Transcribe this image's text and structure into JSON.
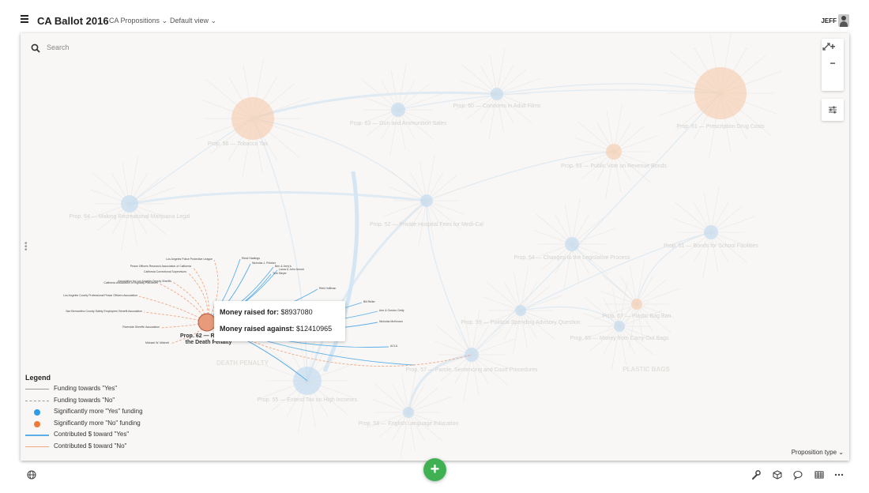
{
  "app": {
    "title": "CA Ballot 2016",
    "dataset": "CA Propositions",
    "view": "Default view",
    "user": "JEFF"
  },
  "search": {
    "placeholder": "Search"
  },
  "zoom": {
    "in": "+",
    "out": "−"
  },
  "tooltip": {
    "for_label": "Money raised for:",
    "for_value": "$8937080",
    "against_label": "Money raised against:",
    "against_value": "$12410965"
  },
  "legend": {
    "title": "Legend",
    "items": [
      {
        "label": "Funding towards \"Yes\"",
        "color": "#9a9a9a",
        "style": "solid"
      },
      {
        "label": "Funding towards \"No\"",
        "color": "#9a9a9a",
        "style": "dashed"
      },
      {
        "label": "Significantly more \"Yes\" funding",
        "color": "#2f9ae6",
        "style": "dot"
      },
      {
        "label": "Significantly more \"No\" funding",
        "color": "#f07a3a",
        "style": "dot"
      },
      {
        "label": "Contributed $ toward \"Yes\"",
        "color": "#5aaee8",
        "style": "solid"
      },
      {
        "label": "Contributed $ toward \"No\"",
        "color": "#f0a785",
        "style": "solid"
      }
    ]
  },
  "proposition_type_label": "Proposition type",
  "focus_node": {
    "label_line1": "Prop. 62 — Repealing",
    "label_line2": "the Death Penalty",
    "color": "#e79a7c"
  },
  "nodes": [
    {
      "label": "Prop. 56 — Tobacco Tax",
      "color": "#f6c6a4"
    },
    {
      "label": "Prop. 63 — Gun and Ammunition Sales",
      "color": "#b8d6ef"
    },
    {
      "label": "Prop. 60 — Condoms in Adult Films",
      "color": "#b8d6ef"
    },
    {
      "label": "Prop. 61 — Prescription Drug Costs",
      "color": "#f6c6a4"
    },
    {
      "label": "Prop. 53 — Public Vote on Revenue Bonds",
      "color": "#f6c6a4"
    },
    {
      "label": "Prop. 64 — Making Recreational Marijuana Legal",
      "color": "#b8d6ef"
    },
    {
      "label": "Prop. 52 — Private Hospital Fees for Medi-Cal",
      "color": "#b8d6ef"
    },
    {
      "label": "Prop. 54 — Changes to the Legislative Process",
      "color": "#b8d6ef"
    },
    {
      "label": "Prop. 51 — Bonds for School Facilities",
      "color": "#b8d6ef"
    },
    {
      "label": "Prop. 59 — Political Spending Advisory Question",
      "color": "#b8d6ef"
    },
    {
      "label": "Prop. 67 — Plastic Bag Ban",
      "color": "#f6c6a4"
    },
    {
      "label": "Prop. 65 — Money from Carry-Out Bags",
      "color": "#b8d6ef"
    },
    {
      "label": "Prop. 57 — Parole, Sentencing and Court Procedures",
      "color": "#b8d6ef"
    },
    {
      "label": "Prop. 55 — Extend Tax on High Incomes",
      "color": "#b8d6ef"
    },
    {
      "label": "Prop. 58 — English Language Education",
      "color": "#b8d6ef"
    }
  ],
  "group_labels": [
    "DEATH PENALTY",
    "PLASTIC BAGS"
  ],
  "contributors_no": [
    "Los Angeles Police Protective League",
    "Peace Officers Research Association of California",
    "California Correctional Supervisors",
    "Association for Los Angeles Deputy Sheriffs",
    "California Association of Highway Patrolmen",
    "Los Angeles County Professional Peace Officers Association",
    "San Bernardino County Safety Employees' Benefit Association",
    "Riverside Sheriffs' Association",
    "Michael W. Mitchell"
  ],
  "contributors_yes": [
    "Reed Hastings",
    "Nicholas J. Pritzker",
    "Ben & Jerry's",
    "Laura & John Arnold",
    "Tom Steyer",
    "Reid Hoffman",
    "Bill Reller",
    "Ann & Gordon Getty",
    "Nicholas McKeown",
    "ACLU"
  ]
}
